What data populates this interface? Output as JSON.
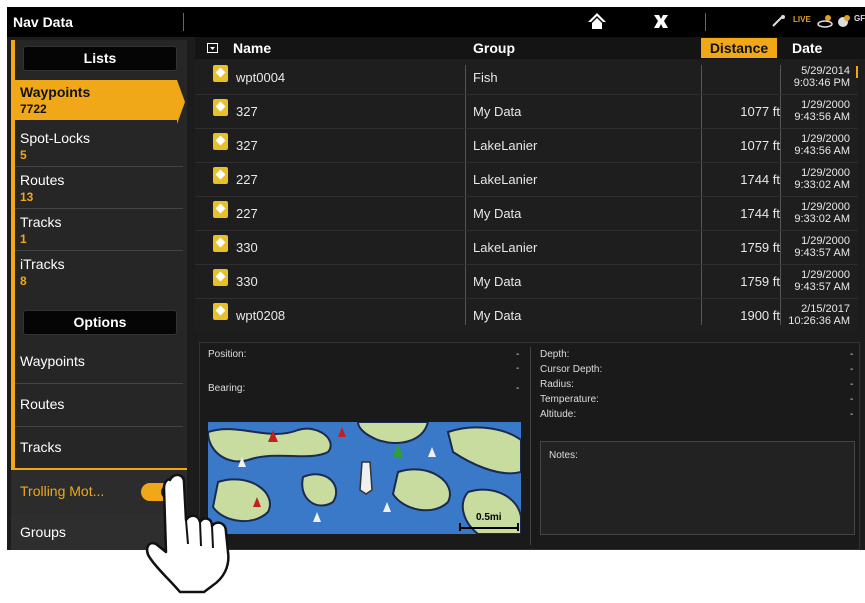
{
  "topbar": {
    "title": "Nav Data",
    "home_icon": "home-icon",
    "close_icon": "close-icon",
    "status": {
      "live": "LIVE",
      "gps_text": "GF"
    }
  },
  "sidebar": {
    "lists_header": "Lists",
    "lists": [
      {
        "label": "Waypoints",
        "count": "7722",
        "active": true
      },
      {
        "label": "Spot-Locks",
        "count": "5"
      },
      {
        "label": "Routes",
        "count": "13"
      },
      {
        "label": "Tracks",
        "count": "1"
      },
      {
        "label": "iTracks",
        "count": "8"
      }
    ],
    "options_header": "Options",
    "options": [
      {
        "label": "Waypoints"
      },
      {
        "label": "Routes"
      },
      {
        "label": "Tracks"
      }
    ],
    "trolling": {
      "label": "Trolling Mot...",
      "toggle_on": true
    },
    "groups": "Groups"
  },
  "table": {
    "columns": {
      "name": "Name",
      "group": "Group",
      "distance": "Distance",
      "date": "Date"
    },
    "sorted_by": "Distance",
    "rows": [
      {
        "name": "wpt0004",
        "group": "Fish",
        "distance": "",
        "date": "5/29/2014",
        "time": "9:03:46 PM"
      },
      {
        "name": "327",
        "group": "My Data",
        "distance": "1077 ft",
        "date": "1/29/2000",
        "time": "9:43:56 AM"
      },
      {
        "name": "327",
        "group": "LakeLanier",
        "distance": "1077 ft",
        "date": "1/29/2000",
        "time": "9:43:56 AM"
      },
      {
        "name": "227",
        "group": "LakeLanier",
        "distance": "1744 ft",
        "date": "1/29/2000",
        "time": "9:33:02 AM"
      },
      {
        "name": "227",
        "group": "My Data",
        "distance": "1744 ft",
        "date": "1/29/2000",
        "time": "9:33:02 AM"
      },
      {
        "name": "330",
        "group": "LakeLanier",
        "distance": "1759 ft",
        "date": "1/29/2000",
        "time": "9:43:57 AM"
      },
      {
        "name": "330",
        "group": "My Data",
        "distance": "1759 ft",
        "date": "1/29/2000",
        "time": "9:43:57 AM"
      },
      {
        "name": "wpt0208",
        "group": "My Data",
        "distance": "1900 ft",
        "date": "2/15/2017",
        "time": "10:26:36 AM"
      }
    ]
  },
  "details": {
    "position_label": "Position:",
    "position_value": "-",
    "position_value2": "-",
    "bearing_label": "Bearing:",
    "bearing_value": "-",
    "depth_label": "Depth:",
    "depth_value": "-",
    "cursor_depth_label": "Cursor Depth:",
    "cursor_depth_value": "-",
    "radius_label": "Radius:",
    "radius_value": "-",
    "temperature_label": "Temperature:",
    "temperature_value": "-",
    "altitude_label": "Altitude:",
    "altitude_value": "-",
    "notes_label": "Notes:",
    "map_scale": "0.5mi"
  },
  "colors": {
    "accent": "#f0a818",
    "background": "#1c1c1c",
    "waypoint": "#e8c028",
    "water": "#3a78c8",
    "land": "#c8dca0"
  }
}
